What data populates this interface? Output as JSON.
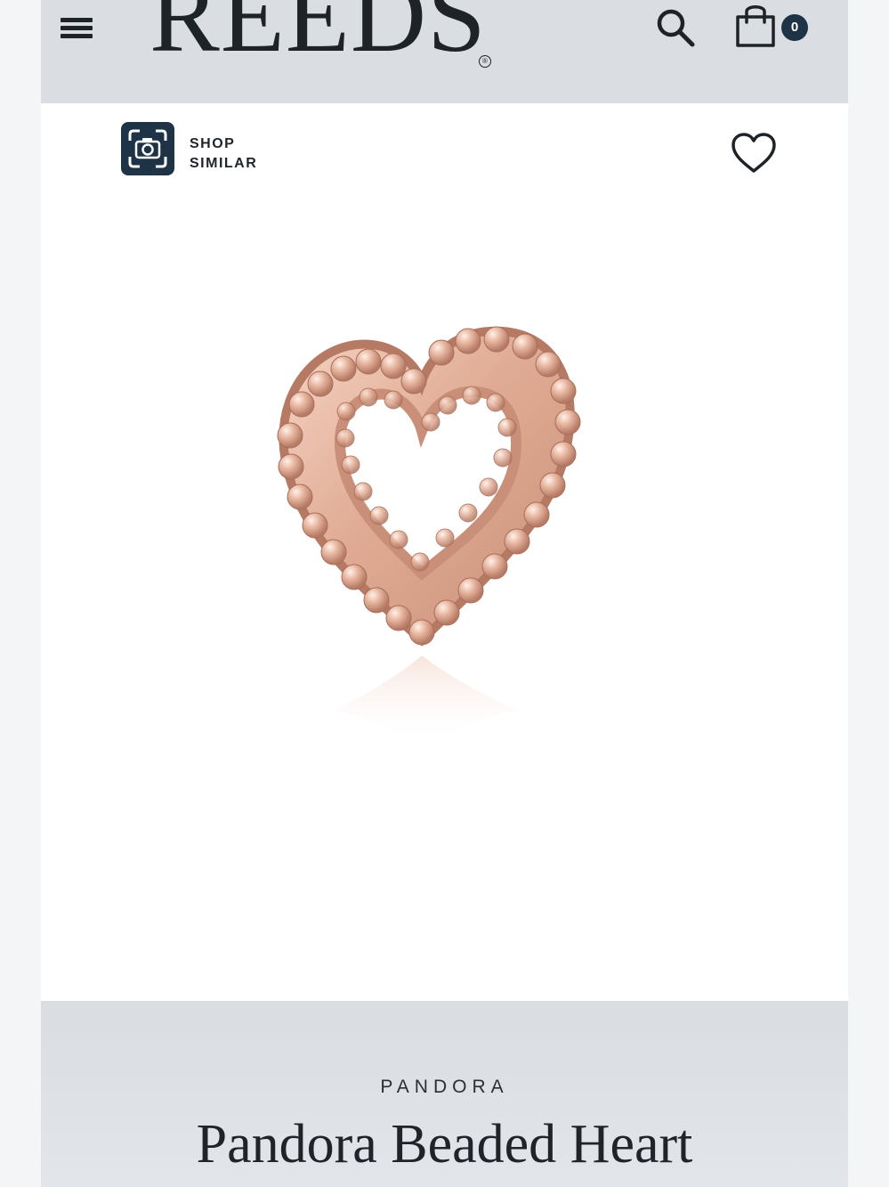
{
  "header": {
    "logo_text": "REEDS",
    "logo_mark": "®",
    "menu_icon": "hamburger-menu-icon",
    "search_icon": "search-icon",
    "cart_icon": "shopping-bag-icon",
    "cart_count": "0"
  },
  "product_card": {
    "shop_similar_label": "SHOP SIMILAR",
    "shop_similar_icon": "camera-scan-icon",
    "wishlist_icon": "heart-outline-icon",
    "product_image_alt": "Pandora Beaded Heart"
  },
  "product": {
    "brand": "PANDORA",
    "title": "Pandora Beaded Heart"
  },
  "colors": {
    "header_background": "#dadee2",
    "brand_navy": "#1f3347",
    "rose_gold": "#e0ab94",
    "page_background": "#f4f5f7"
  }
}
